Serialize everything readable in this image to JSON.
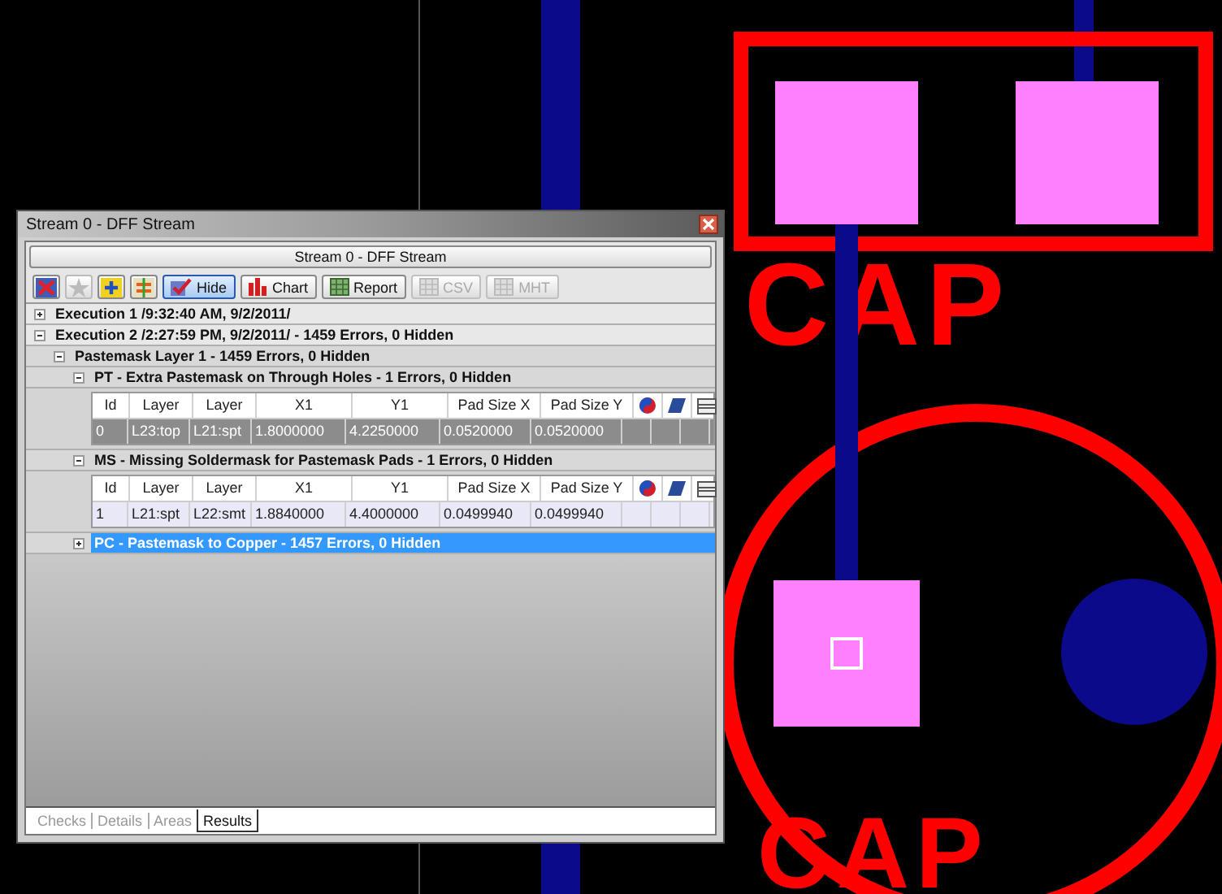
{
  "window": {
    "title": "Stream 0 - DFF Stream"
  },
  "header": "Stream 0 - DFF Stream",
  "toolbar": {
    "icon_buttons": [
      {
        "disabled": false
      },
      {
        "disabled": true
      },
      {
        "disabled": false
      },
      {
        "disabled": false
      }
    ],
    "buttons": [
      {
        "label": "Hide",
        "selected": true,
        "disabled": false
      },
      {
        "label": "Chart",
        "selected": false,
        "disabled": false
      },
      {
        "label": "Report",
        "selected": false,
        "disabled": false
      },
      {
        "label": "CSV",
        "selected": false,
        "disabled": true
      },
      {
        "label": "MHT",
        "selected": false,
        "disabled": true
      }
    ]
  },
  "tree": [
    {
      "label": "Execution 1 /9:32:40 AM, 9/2/2011/",
      "expanded": false,
      "selected": false
    },
    {
      "label": "Execution 2 /2:27:59 PM, 9/2/2011/ - 1459 Errors, 0 Hidden",
      "expanded": true,
      "selected": false,
      "children": [
        {
          "label": "Pastemask Layer 1 - 1459 Errors, 0 Hidden",
          "expanded": true,
          "selected": false,
          "children": [
            {
              "label": "PT - Extra Pastemask on Through Holes - 1 Errors, 0 Hidden",
              "expanded": true,
              "selected": false,
              "table": {
                "columns": [
                  "Id",
                  "Layer",
                  "Layer",
                  "X1",
                  "Y1",
                  "Pad Size X",
                  "Pad Size Y"
                ],
                "rows": [
                  {
                    "cells": [
                      "0",
                      "L23:top",
                      "L21:spt",
                      "1.8000000",
                      "4.2250000",
                      "0.0520000",
                      "0.0520000"
                    ],
                    "selected": true
                  }
                ]
              }
            },
            {
              "label": "MS - Missing Soldermask for Pastemask Pads - 1 Errors, 0 Hidden",
              "expanded": true,
              "selected": false,
              "table": {
                "columns": [
                  "Id",
                  "Layer",
                  "Layer",
                  "X1",
                  "Y1",
                  "Pad Size X",
                  "Pad Size Y"
                ],
                "rows": [
                  {
                    "cells": [
                      "1",
                      "L21:spt",
                      "L22:smt",
                      "1.8840000",
                      "4.4000000",
                      "0.0499940",
                      "0.0499940"
                    ],
                    "selected": false
                  }
                ]
              }
            },
            {
              "label": "PC - Pastemask to Copper - 1457 Errors, 0 Hidden",
              "expanded": false,
              "selected": true
            }
          ]
        }
      ]
    }
  ],
  "tabs": [
    {
      "label": "Checks",
      "selected": false
    },
    {
      "label": "Details",
      "selected": false
    },
    {
      "label": "Areas",
      "selected": false
    },
    {
      "label": "Results",
      "selected": true
    }
  ],
  "board": {
    "silkscreen": [
      "CAP",
      "CAP"
    ]
  }
}
